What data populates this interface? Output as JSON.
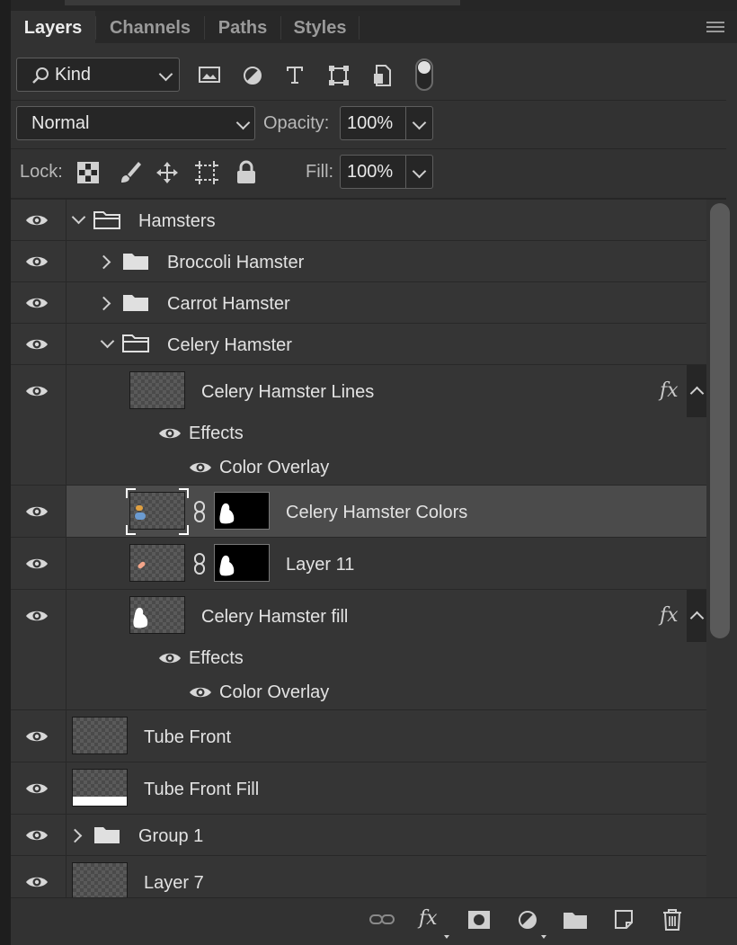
{
  "tabs": [
    {
      "label": "Layers",
      "active": true
    },
    {
      "label": "Channels",
      "active": false
    },
    {
      "label": "Paths",
      "active": false
    },
    {
      "label": "Styles",
      "active": false
    }
  ],
  "filter": {
    "kind_label": "Kind"
  },
  "blend": {
    "mode": "Normal",
    "opacity_label": "Opacity:",
    "opacity_value": "100%"
  },
  "lock": {
    "label": "Lock:",
    "fill_label": "Fill:",
    "fill_value": "100%"
  },
  "layers": [
    {
      "name": "Hamsters",
      "type": "group",
      "expanded": true
    },
    {
      "name": "Broccoli Hamster",
      "type": "group",
      "expanded": false
    },
    {
      "name": "Carrot Hamster",
      "type": "group",
      "expanded": false
    },
    {
      "name": "Celery Hamster",
      "type": "group",
      "expanded": true
    },
    {
      "name": "Celery Hamster Lines",
      "type": "layer",
      "fx": "fx",
      "effects_label": "Effects",
      "effect": "Color Overlay"
    },
    {
      "name": "Celery Hamster Colors",
      "type": "layer",
      "selected": true
    },
    {
      "name": "Layer 11",
      "type": "layer"
    },
    {
      "name": "Celery Hamster fill",
      "type": "layer",
      "fx": "fx",
      "effects_label": "Effects",
      "effect": "Color Overlay"
    },
    {
      "name": "Tube Front",
      "type": "layer"
    },
    {
      "name": "Tube Front Fill",
      "type": "layer"
    },
    {
      "name": "Group 1",
      "type": "group",
      "expanded": false
    },
    {
      "name": "Layer 7",
      "type": "layer"
    }
  ],
  "bottom_fx_label": "fx",
  "colors": {
    "panel": "#323232",
    "row": "#353535",
    "selected_row": "#4b4b4b",
    "text": "#e2e2e2"
  }
}
